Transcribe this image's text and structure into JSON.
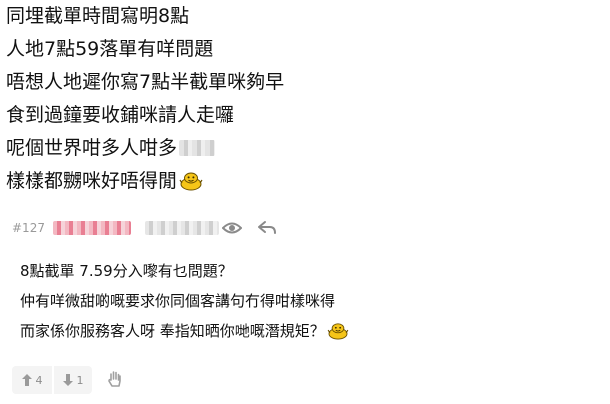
{
  "post_lines": [
    "同埋截單時間寫明8點",
    "人地7點59落單有咩問題",
    "唔想人地遲你寫7點半截單咪夠早",
    "食到過鐘要收鋪咪請人走囉",
    "呢個世界咁多人咁多",
    "樣樣都嬲咪好唔得閒"
  ],
  "reply": {
    "post_number": "#127",
    "lines": [
      "8點截單 7.59分入嚟有乜問題？",
      "仲有咩微甜啲嘅要求你同個客講句冇得咁樣咪得",
      "而家係你服務客人呀 奉指知晒你哋嘅潛規矩？"
    ],
    "upvotes": "4",
    "downvotes": "1"
  },
  "icons": {
    "emoji": "seal-emoji-icon",
    "view": "eye-icon",
    "reply": "reply-arrow-icon",
    "upvote": "thumb-up-icon",
    "downvote": "thumb-down-icon",
    "report": "hand-icon"
  },
  "colors": {
    "text": "#111111",
    "meta": "#9a9a9a",
    "emoji_yellow": "#f5c518"
  }
}
